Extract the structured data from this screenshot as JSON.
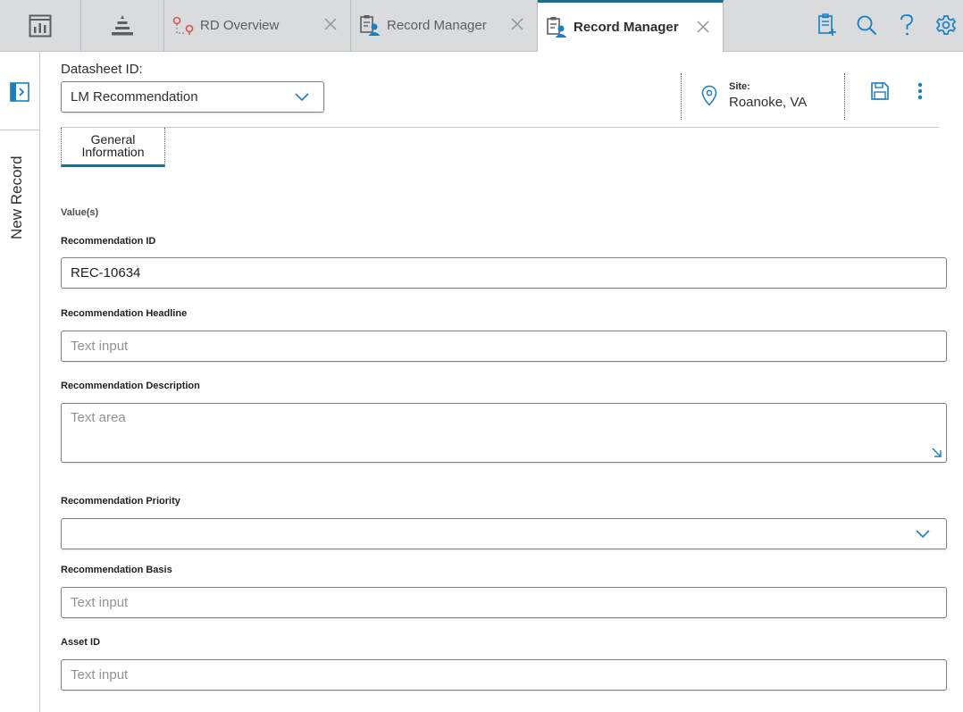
{
  "tabs": [
    {
      "label": "RD Overview",
      "icon": "rd-overview-icon"
    },
    {
      "label": "Record Manager",
      "icon": "record-manager-icon"
    },
    {
      "label": "Record Manager",
      "icon": "record-manager-icon",
      "active": true
    }
  ],
  "datasheet": {
    "label": "Datasheet ID:",
    "value": "LM Recommendation"
  },
  "site": {
    "label": "Site:",
    "value": "Roanoke, VA"
  },
  "rail": {
    "label": "New Record"
  },
  "section_tab": {
    "label": "General Information"
  },
  "form": {
    "values_label": "Value(s)",
    "recommendation_id": {
      "label": "Recommendation ID",
      "value": "REC-10634"
    },
    "headline": {
      "label": "Recommendation Headline",
      "placeholder": "Text input"
    },
    "description": {
      "label": "Recommendation Description",
      "placeholder": "Text area"
    },
    "priority": {
      "label": "Recommendation Priority",
      "value": ""
    },
    "basis": {
      "label": "Recommendation Basis",
      "placeholder": "Text input"
    },
    "asset_id": {
      "label": "Asset ID",
      "placeholder": "Text input"
    }
  },
  "colors": {
    "accent": "#1c6e8c",
    "icon_blue": "#1a7fc1",
    "tab_bar": "#d9dbdd"
  }
}
